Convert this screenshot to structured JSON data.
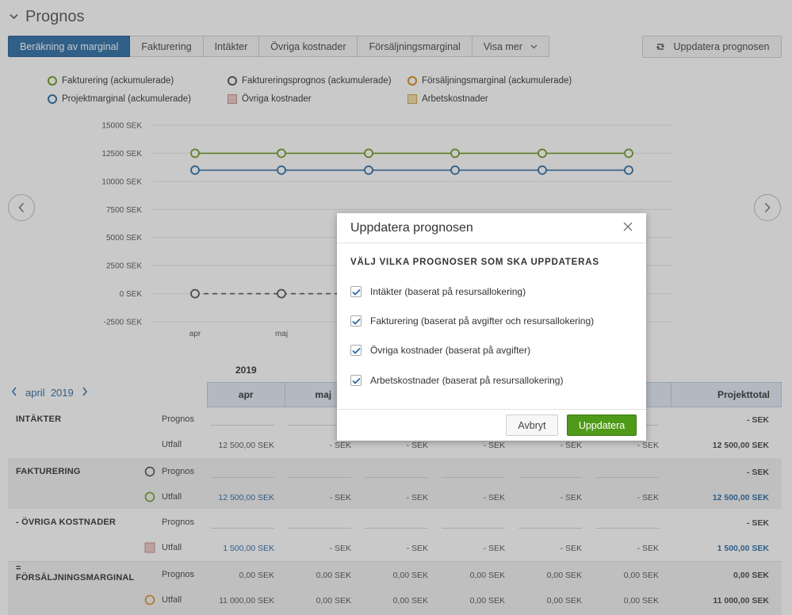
{
  "header": {
    "title": "Prognos",
    "collapse_icon": "chevron-down-icon"
  },
  "tabs": [
    {
      "label": "Beräkning av marginal",
      "active": true
    },
    {
      "label": "Fakturering",
      "active": false
    },
    {
      "label": "Intäkter",
      "active": false
    },
    {
      "label": "Övriga kostnader",
      "active": false
    },
    {
      "label": "Försäljningsmarginal",
      "active": false
    },
    {
      "label": "Visa mer",
      "active": false,
      "dropdown": true
    }
  ],
  "update_button": {
    "label": "Uppdatera prognosen",
    "icon": "refresh-icon"
  },
  "legend": [
    {
      "label": "Fakturering (ackumulerade)",
      "shape": "circle",
      "color": "#6d9a1f"
    },
    {
      "label": "Faktureringsprognos (ackumulerade)",
      "shape": "circle",
      "color": "#555555"
    },
    {
      "label": "Försäljningsmarginal (ackumulerade)",
      "shape": "circle",
      "color": "#d98a1a"
    },
    {
      "label": "Projektmarginal (ackumulerade)",
      "shape": "circle",
      "color": "#2b6ca6"
    },
    {
      "label": "Övriga kostnader",
      "shape": "square",
      "color": "#e8b4b0"
    },
    {
      "label": "Arbetskostnader",
      "shape": "square",
      "color": "#f0d48a"
    }
  ],
  "chart_data": {
    "type": "line",
    "x_tick_labels": [
      "apr",
      "maj"
    ],
    "y_ticks": [
      15000,
      12500,
      10000,
      7500,
      5000,
      2500,
      0,
      -2500
    ],
    "y_tick_labels": [
      "15000 SEK",
      "12500 SEK",
      "10000 SEK",
      "7500 SEK",
      "5000 SEK",
      "2500 SEK",
      "0 SEK",
      "-2500 SEK"
    ],
    "ylim": [
      -2500,
      15000
    ],
    "grid": true,
    "series": [
      {
        "name": "Fakturering (ackumulerade)",
        "color": "#6d9a1f",
        "values": [
          12500,
          12500,
          12500,
          12500,
          12500,
          12500
        ]
      },
      {
        "name": "Projektmarginal (ackumulerade)",
        "color": "#2b6ca6",
        "values": [
          11000,
          11000,
          11000,
          11000,
          11000,
          11000
        ]
      },
      {
        "name": "Faktureringsprognos (ackumulerade)",
        "color": "#555555",
        "dashed": true,
        "values": [
          0,
          0
        ]
      }
    ]
  },
  "nav": {
    "prev_icon": "chevron-left-icon",
    "next_icon": "chevron-right-icon"
  },
  "table": {
    "year": "2019",
    "month_nav": {
      "month": "april",
      "year": "2019"
    },
    "columns": [
      "apr",
      "maj",
      "",
      "",
      "",
      "",
      "Projekttotal"
    ],
    "sections": [
      {
        "title": "INTÄKTER",
        "rows": [
          {
            "label": "Prognos",
            "cells": [
              "",
              "",
              "",
              "",
              "",
              ""
            ],
            "total": "- SEK"
          },
          {
            "label": "Utfall",
            "cells": [
              "12 500,00 SEK",
              "- SEK",
              "- SEK",
              "- SEK",
              "- SEK",
              "- SEK"
            ],
            "total": "12 500,00 SEK"
          }
        ]
      },
      {
        "title": "FAKTURERING",
        "rows": [
          {
            "label": "Prognos",
            "icon": "circle-dark",
            "cells": [
              "",
              "",
              "",
              "",
              "",
              ""
            ],
            "total": "- SEK"
          },
          {
            "label": "Utfall",
            "icon": "circle-green",
            "cells": [
              "12 500,00 SEK",
              "- SEK",
              "- SEK",
              "- SEK",
              "- SEK",
              "- SEK"
            ],
            "total": "12 500,00 SEK",
            "link": true
          }
        ]
      },
      {
        "title": "- ÖVRIGA KOSTNADER",
        "rows": [
          {
            "label": "Prognos",
            "cells": [
              "",
              "",
              "",
              "",
              "",
              ""
            ],
            "total": "- SEK"
          },
          {
            "label": "Utfall",
            "icon": "square-pink",
            "cells": [
              "1 500,00 SEK",
              "- SEK",
              "- SEK",
              "- SEK",
              "- SEK",
              "- SEK"
            ],
            "total": "1 500,00 SEK",
            "link": true
          }
        ]
      },
      {
        "title_line1": "=",
        "title": "FÖRSÄLJNINGSMARGINAL",
        "rows": [
          {
            "label": "Prognos",
            "cells": [
              "0,00 SEK",
              "0,00 SEK",
              "0,00 SEK",
              "0,00 SEK",
              "0,00 SEK",
              "0,00 SEK"
            ],
            "total": "0,00 SEK"
          },
          {
            "label": "Utfall",
            "icon": "circle-orange",
            "cells": [
              "11 000,00 SEK",
              "0,00 SEK",
              "0,00 SEK",
              "0,00 SEK",
              "0,00 SEK",
              "0,00 SEK"
            ],
            "total": "11 000,00 SEK"
          }
        ]
      }
    ]
  },
  "modal": {
    "title": "Uppdatera prognosen",
    "subtitle": "VÄLJ VILKA PROGNOSER SOM SKA UPPDATERAS",
    "options": [
      {
        "label": "Intäkter (baserat på resursallokering)",
        "checked": true
      },
      {
        "label": "Fakturering (baserat på avgifter och resursallokering)",
        "checked": true
      },
      {
        "label": "Övriga kostnader (baserat på avgifter)",
        "checked": true
      },
      {
        "label": "Arbetskostnader (baserat på resursallokering)",
        "checked": true
      }
    ],
    "cancel_label": "Avbryt",
    "confirm_label": "Uppdatera"
  }
}
